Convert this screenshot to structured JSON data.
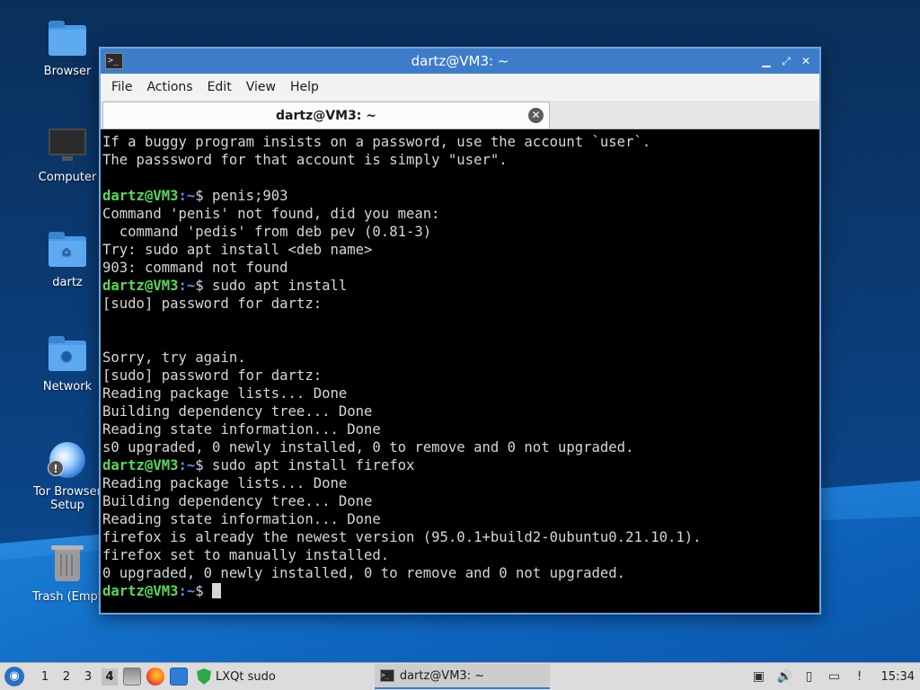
{
  "desktop": {
    "icons": [
      {
        "label": "Browser",
        "icon": "folder-icon"
      },
      {
        "label": "Computer",
        "icon": "monitor-icon"
      },
      {
        "label": "dartz",
        "icon": "home-folder-icon"
      },
      {
        "label": "Network",
        "icon": "network-folder-icon"
      },
      {
        "label": "Tor Browser Setup",
        "icon": "tor-browser-icon"
      },
      {
        "label": "Trash (Empt",
        "icon": "trash-icon"
      }
    ]
  },
  "window": {
    "title": "dartz@VM3: ~",
    "controls": {
      "minimize": "▁",
      "maximize": "⤢",
      "close": "✕"
    },
    "menu": [
      "File",
      "Actions",
      "Edit",
      "View",
      "Help"
    ],
    "tab": {
      "label": "dartz@VM3: ~",
      "close": "✕"
    }
  },
  "terminal": {
    "prompt": {
      "user": "dartz@VM3",
      "path": "~",
      "symbol": "$"
    },
    "lines": [
      {
        "text": "If a buggy program insists on a password, use the account `user`."
      },
      {
        "text": "The passsword for that account is simply \"user\"."
      },
      {
        "text": ""
      },
      {
        "prompt": true,
        "text": " penis;903"
      },
      {
        "text": "Command 'penis' not found, did you mean:"
      },
      {
        "text": "  command 'pedis' from deb pev (0.81-3)"
      },
      {
        "text": "Try: sudo apt install <deb name>"
      },
      {
        "text": "903: command not found"
      },
      {
        "prompt": true,
        "text": " sudo apt install"
      },
      {
        "text": "[sudo] password for dartz:"
      },
      {
        "text": ""
      },
      {
        "text": ""
      },
      {
        "text": "Sorry, try again."
      },
      {
        "text": "[sudo] password for dartz:"
      },
      {
        "text": "Reading package lists... Done"
      },
      {
        "text": "Building dependency tree... Done"
      },
      {
        "text": "Reading state information... Done"
      },
      {
        "text": "s0 upgraded, 0 newly installed, 0 to remove and 0 not upgraded."
      },
      {
        "prompt": true,
        "text": " sudo apt install firefox"
      },
      {
        "text": "Reading package lists... Done"
      },
      {
        "text": "Building dependency tree... Done"
      },
      {
        "text": "Reading state information... Done"
      },
      {
        "text": "firefox is already the newest version (95.0.1+build2-0ubuntu0.21.10.1)."
      },
      {
        "text": "firefox set to manually installed."
      },
      {
        "text": "0 upgraded, 0 newly installed, 0 to remove and 0 not upgraded."
      },
      {
        "prompt": true,
        "text": " ",
        "cursor": true
      }
    ]
  },
  "taskbar": {
    "start_icon": "lxqt-start-icon",
    "workspaces": [
      "1",
      "2",
      "3",
      "4"
    ],
    "active_workspace": "4",
    "quicklaunch": [
      "file-manager-icon",
      "firefox-icon",
      "show-desktop-icon"
    ],
    "sudo_label": "LXQt sudo",
    "task": {
      "label": "dartz@VM3: ~"
    },
    "tray": [
      "clipboard-icon",
      "volume-icon",
      "battery-icon",
      "network-icon",
      "update-notifier-icon"
    ],
    "clock": "15:34"
  },
  "colors": {
    "prompt_user": "#57d957",
    "prompt_path": "#5c8cff",
    "titlebar": "#3d7cc9",
    "terminal_bg": "#000000",
    "terminal_fg": "#d6d6d6"
  }
}
